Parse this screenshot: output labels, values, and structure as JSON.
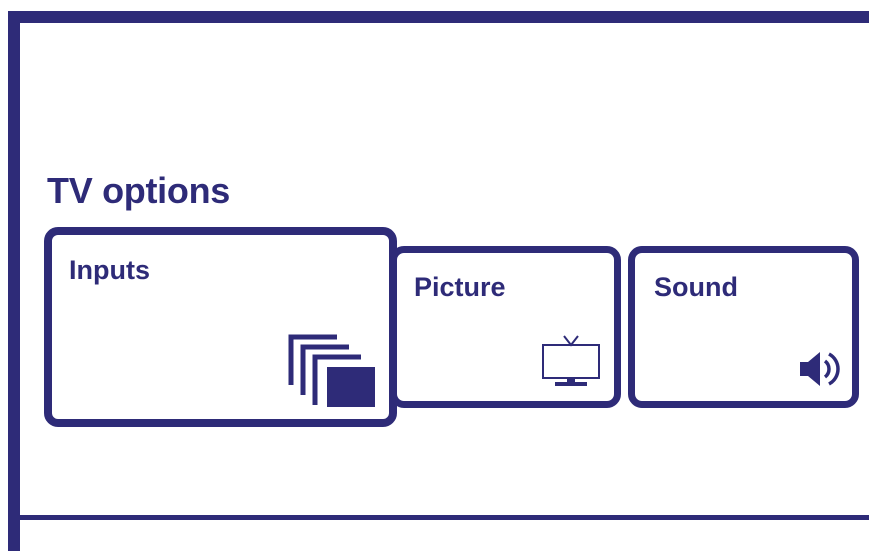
{
  "screen": {
    "title": "TV options",
    "accent_color": "#2e2b78"
  },
  "tiles": [
    {
      "label": "Inputs",
      "icon": "inputs-stack-icon",
      "focused": true
    },
    {
      "label": "Picture",
      "icon": "tv-icon",
      "focused": false
    },
    {
      "label": "Sound",
      "icon": "speaker-icon",
      "focused": false
    }
  ]
}
